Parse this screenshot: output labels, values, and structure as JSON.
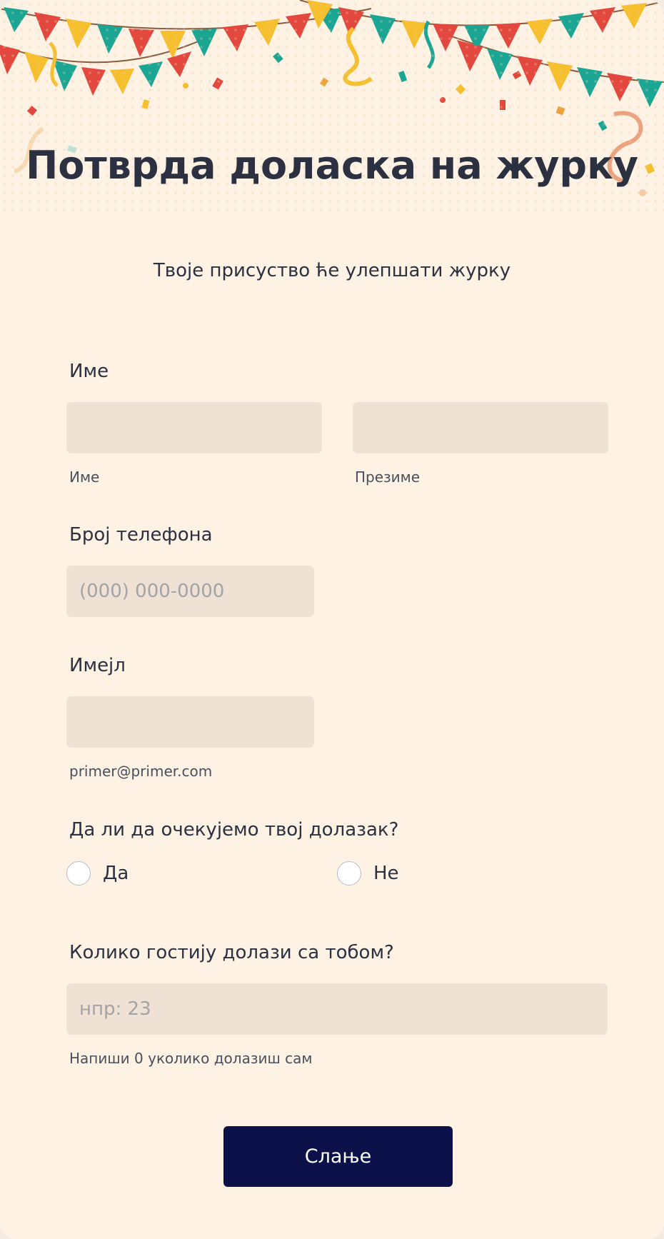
{
  "header": {
    "title": "Потврда доласка на журку",
    "subtitle": "Твоје присуство ће улепшати журку"
  },
  "fields": {
    "name": {
      "label": "Име",
      "first_value": "",
      "first_sublabel": "Име",
      "last_value": "",
      "last_sublabel": "Презиме"
    },
    "phone": {
      "label": "Број телефона",
      "value": "",
      "placeholder": "(000) 000-0000"
    },
    "email": {
      "label": "Имејл",
      "value": "",
      "sublabel": "primer@primer.com"
    },
    "attendance": {
      "label": "Да ли да очекујемо твој долазак?",
      "options": [
        "Да",
        "Не"
      ]
    },
    "guests": {
      "label": "Колико гостију долази са тобом?",
      "value": "",
      "placeholder": "нпр: 23",
      "sublabel": "Напиши 0 уколико долазиш сам"
    }
  },
  "submit_label": "Слање",
  "colors": {
    "background": "#fdf2e4",
    "input_fill": "#efe1d4",
    "text": "#2c3142",
    "button": "#0c1149",
    "flag_teal": "#1aa693",
    "flag_red": "#e2483d",
    "flag_yellow": "#f6bf2e"
  },
  "icons": [
    "party-bunting-banner",
    "confetti"
  ]
}
